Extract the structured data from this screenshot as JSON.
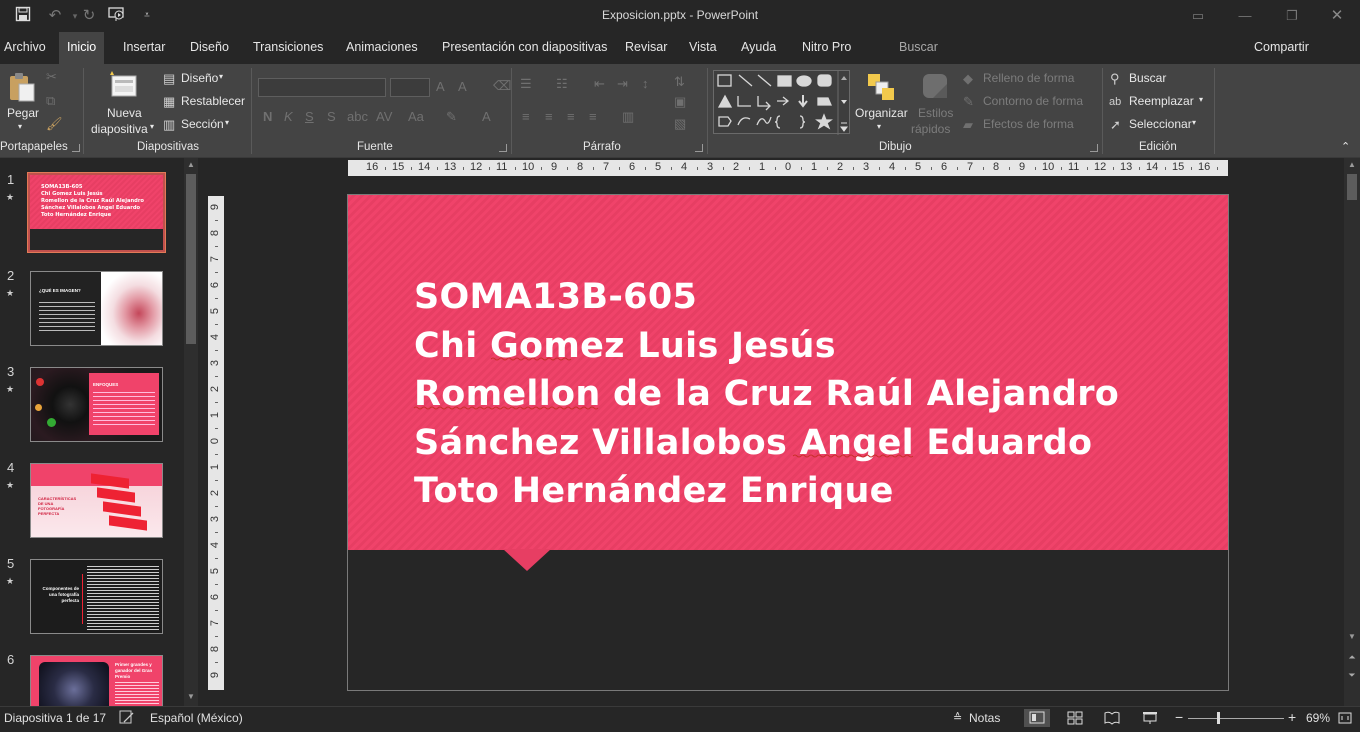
{
  "window": {
    "title": "Exposicion.pptx  -  PowerPoint",
    "quick_access": [
      "save-icon",
      "undo-icon",
      "redo-icon",
      "present-from-start-icon",
      "customize-qat-icon"
    ]
  },
  "tabs": [
    {
      "label": "Archivo"
    },
    {
      "label": "Inicio",
      "active": true
    },
    {
      "label": "Insertar"
    },
    {
      "label": "Diseño"
    },
    {
      "label": "Transiciones"
    },
    {
      "label": "Animaciones"
    },
    {
      "label": "Presentación con diapositivas"
    },
    {
      "label": "Revisar"
    },
    {
      "label": "Vista"
    },
    {
      "label": "Ayuda"
    },
    {
      "label": "Nitro Pro"
    }
  ],
  "search_placeholder": "Buscar",
  "share_label": "Compartir",
  "ribbon": {
    "clipboard": {
      "paste": "Pegar",
      "group": "Portapapeles"
    },
    "slides": {
      "new_slide_1": "Nueva",
      "new_slide_2": "diapositiva",
      "layout": "Diseño",
      "reset": "Restablecer",
      "section": "Sección",
      "group": "Diapositivas"
    },
    "font": {
      "group": "Fuente"
    },
    "paragraph": {
      "group": "Párrafo"
    },
    "drawing": {
      "arrange": "Organizar",
      "quick_styles_1": "Estilos",
      "quick_styles_2": "rápidos",
      "shape_fill": "Relleno de forma",
      "shape_outline": "Contorno de forma",
      "shape_effects": "Efectos de forma",
      "group": "Dibujo"
    },
    "editing": {
      "find": "Buscar",
      "replace": "Reemplazar",
      "select": "Seleccionar",
      "group": "Edición"
    }
  },
  "thumbnails": [
    {
      "number": "1",
      "lines": [
        "SOMA13B-605",
        "Chi Gomez Luis Jesús",
        "Romellon de la Cruz Raúl Alejandro",
        "Sánchez Villalobos Angel Eduardo",
        "Toto Hernández Enrique"
      ]
    },
    {
      "number": "2",
      "heading": "¿QUÉ ES IMAGEN?"
    },
    {
      "number": "3",
      "heading": "ENFOQUES"
    },
    {
      "number": "4",
      "heading": "CARACTERÍSTICAS DE UNA FOTOGRAFÍA PERFECTA"
    },
    {
      "number": "5",
      "heading": "Componentes de una fotografía perfecta"
    },
    {
      "number": "6",
      "heading": "Primer grandes y ganador del Gran Premio"
    }
  ],
  "slide": {
    "lines": [
      "SOMA13B-605",
      "Chi Gomez Luis Jesús",
      "Romellon de la Cruz Raúl Alejandro",
      "Sánchez Villalobos Angel Eduardo",
      "Toto Hernández Enrique"
    ]
  },
  "ruler_h": [
    "16",
    "15",
    "14",
    "13",
    "12",
    "11",
    "10",
    "9",
    "8",
    "7",
    "6",
    "5",
    "4",
    "3",
    "2",
    "1",
    "0",
    "1",
    "2",
    "3",
    "4",
    "5",
    "6",
    "7",
    "8",
    "9",
    "10",
    "11",
    "12",
    "13",
    "14",
    "15",
    "16"
  ],
  "ruler_v": [
    "9",
    "8",
    "7",
    "6",
    "5",
    "4",
    "3",
    "2",
    "1",
    "0",
    "1",
    "2",
    "3",
    "4",
    "5",
    "6",
    "7",
    "8",
    "9"
  ],
  "status": {
    "slide_counter": "Diapositiva 1 de 17",
    "language": "Español (México)",
    "notes": "Notas",
    "zoom": "69%"
  }
}
